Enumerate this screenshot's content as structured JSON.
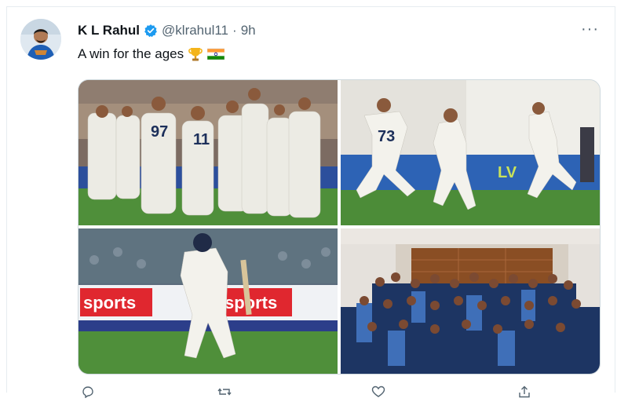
{
  "tweet": {
    "author_name": "K L Rahul",
    "handle": "@klrahul11",
    "separator": "·",
    "time": "9h",
    "text": "A win for the ages",
    "more_label": "···",
    "emojis": [
      "trophy-icon",
      "india-flag-icon"
    ]
  },
  "media": {
    "photos": [
      {
        "id": "team-celebration",
        "jersey_numbers": [
          "97",
          "11"
        ]
      },
      {
        "id": "players-running",
        "jersey_numbers": [
          "73"
        ]
      },
      {
        "id": "batsman-walking",
        "boards": [
          "sports",
          "sports"
        ]
      },
      {
        "id": "dressing-room-group"
      }
    ]
  },
  "actions": [
    "reply-icon",
    "retweet-icon",
    "like-icon",
    "share-icon"
  ],
  "colors": {
    "verified_blue": "#1d9bf0",
    "text_primary": "#0f1419",
    "text_secondary": "#536471",
    "pitch_green": "#4f8f3a",
    "sky_sports_red": "#e0272f"
  }
}
